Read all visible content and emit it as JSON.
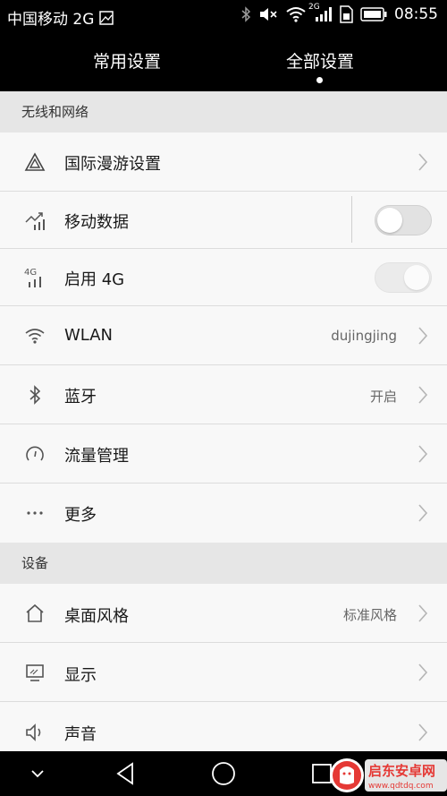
{
  "status_bar": {
    "carrier": "中国移动 2G",
    "network_badge": "2G",
    "time": "08:55",
    "icons": [
      "image-icon",
      "bluetooth-icon",
      "mute-icon",
      "wifi-icon",
      "signal-icon",
      "sim-icon",
      "battery-icon"
    ]
  },
  "tabs": [
    {
      "label": "常用设置",
      "active": false
    },
    {
      "label": "全部设置",
      "active": true
    }
  ],
  "sections": {
    "wireless": "无线和网络",
    "device": "设备"
  },
  "wireless_items": [
    {
      "label": "国际漫游设置",
      "icon": "roaming-triangle-icon",
      "value": "",
      "control": "chevron"
    },
    {
      "label": "移动数据",
      "icon": "mobile-data-icon",
      "value": "",
      "control": "toggle-off"
    },
    {
      "label": "启用 4G",
      "icon": "4g-signal-icon",
      "icon_text": "4G",
      "value": "",
      "control": "toggle-disabled"
    },
    {
      "label": "WLAN",
      "icon": "wifi-icon",
      "value": "dujingjing",
      "control": "chevron"
    },
    {
      "label": "蓝牙",
      "icon": "bluetooth-icon",
      "value": "开启",
      "control": "chevron"
    },
    {
      "label": "流量管理",
      "icon": "gauge-icon",
      "value": "",
      "control": "chevron"
    },
    {
      "label": "更多",
      "icon": "more-dots-icon",
      "value": "",
      "control": "chevron"
    }
  ],
  "device_items": [
    {
      "label": "桌面风格",
      "icon": "home-icon",
      "value": "标准风格",
      "control": "chevron"
    },
    {
      "label": "显示",
      "icon": "display-icon",
      "value": "",
      "control": "chevron"
    },
    {
      "label": "声音",
      "icon": "speaker-icon",
      "value": "",
      "control": "chevron"
    }
  ],
  "nav_bar": [
    "chevron-down-icon",
    "back-icon",
    "home-icon",
    "recents-icon"
  ],
  "watermark": {
    "title": "启东安卓网",
    "url": "www.qdtdq.com"
  },
  "colors": {
    "bars": "#000000",
    "list_bg": "#f8f8f8",
    "section_bg": "#e6e6e6",
    "watermark_red": "#e53935"
  }
}
